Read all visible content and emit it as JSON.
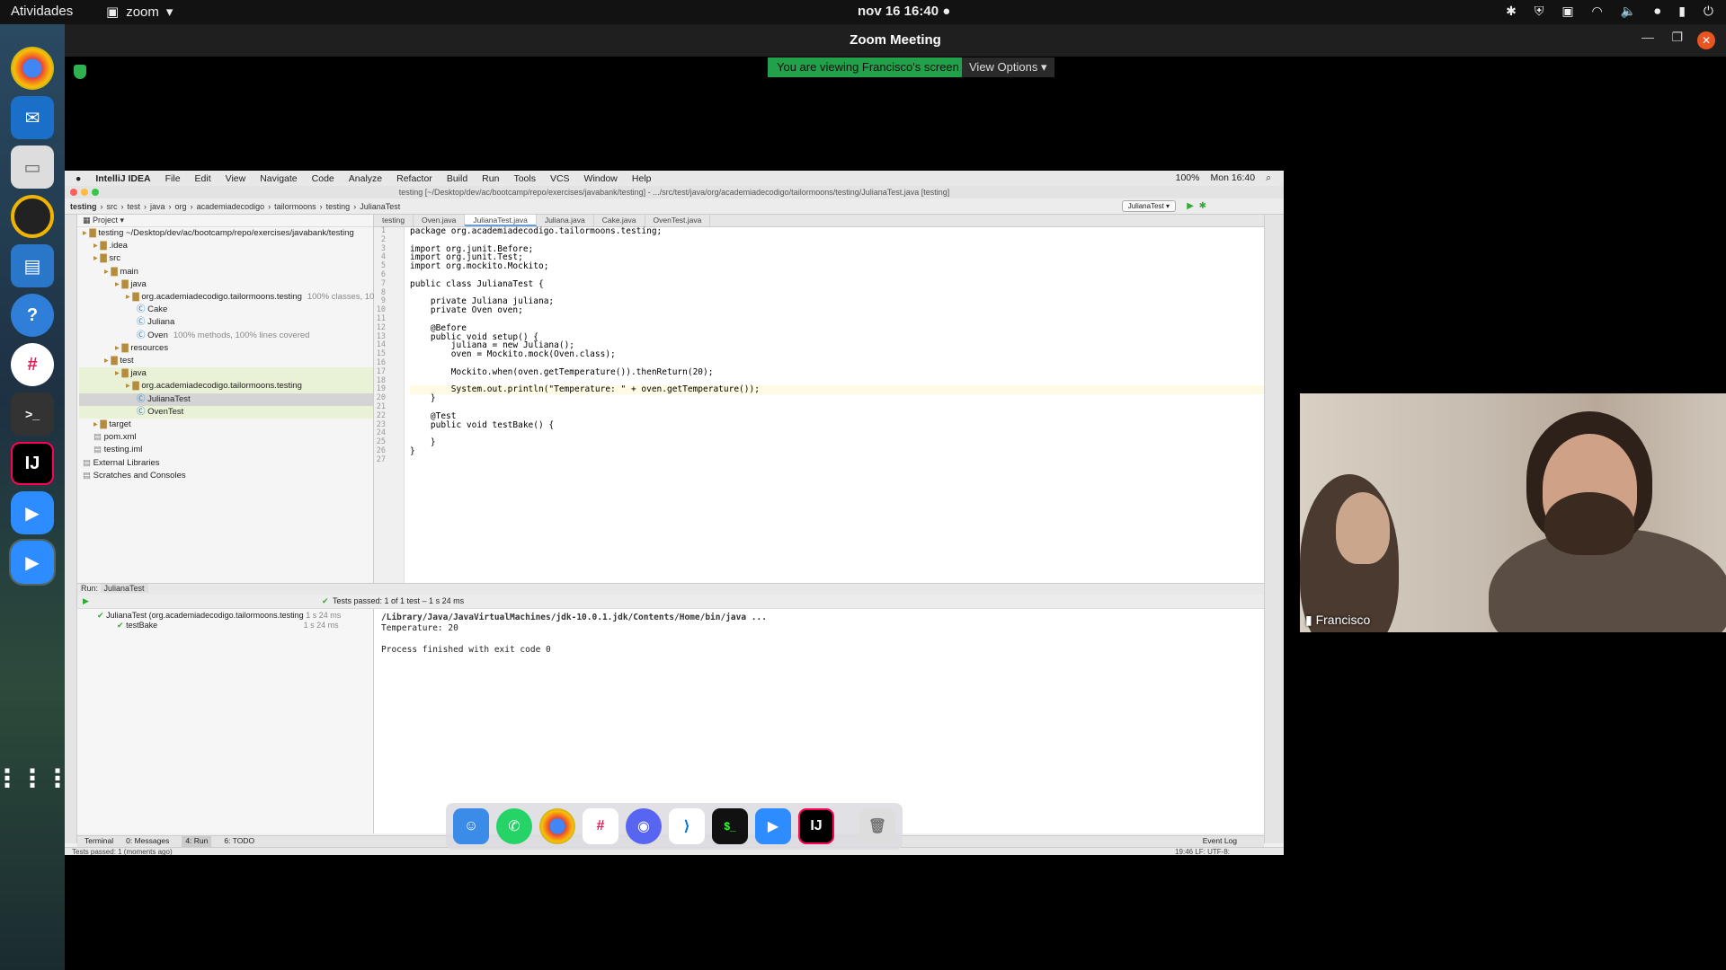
{
  "topbar": {
    "activities": "Atividades",
    "app": "zoom",
    "clock": "nov 16  16:40"
  },
  "zoom": {
    "title": "Zoom Meeting",
    "banner": "You are viewing Francisco's screen",
    "view_options": "View Options",
    "participant": "Francisco"
  },
  "mac": {
    "menu": [
      "IntelliJ IDEA",
      "File",
      "Edit",
      "View",
      "Navigate",
      "Code",
      "Analyze",
      "Refactor",
      "Build",
      "Run",
      "Tools",
      "VCS",
      "Window",
      "Help"
    ],
    "status_right": [
      "100%",
      "Mon 16:40"
    ],
    "title": "testing [~/Desktop/dev/ac/bootcamp/repo/exercises/javabank/testing] - .../src/test/java/org/academiadecodigo/tailormoons/testing/JulianaTest.java [testing]",
    "breadcrumb": [
      "testing",
      "src",
      "test",
      "java",
      "org",
      "academiadecodigo",
      "tailormoons",
      "testing",
      "JulianaTest"
    ],
    "run_config": "JulianaTest"
  },
  "project": {
    "header": "Project",
    "tree": [
      {
        "t": "testing ~/Desktop/dev/ac/bootcamp/repo/exercises/javabank/testing",
        "d": 0,
        "k": "fold"
      },
      {
        "t": ".idea",
        "d": 1,
        "k": "fold"
      },
      {
        "t": "src",
        "d": 1,
        "k": "fold"
      },
      {
        "t": "main",
        "d": 2,
        "k": "fold"
      },
      {
        "t": "java",
        "d": 3,
        "k": "fold"
      },
      {
        "t": "org.academiadecodigo.tailormoons.testing",
        "n": "100% classes, 10",
        "d": 4,
        "k": "fold"
      },
      {
        "t": "Cake",
        "d": 5,
        "k": "cls"
      },
      {
        "t": "Juliana",
        "d": 5,
        "k": "cls"
      },
      {
        "t": "Oven",
        "n": "100% methods, 100% lines covered",
        "d": 5,
        "k": "cls"
      },
      {
        "t": "resources",
        "d": 3,
        "k": "fold"
      },
      {
        "t": "test",
        "d": 2,
        "k": "fold"
      },
      {
        "t": "java",
        "d": 3,
        "k": "fold",
        "h": "hl"
      },
      {
        "t": "org.academiadecodigo.tailormoons.testing",
        "d": 4,
        "k": "fold",
        "h": "hl"
      },
      {
        "t": "JulianaTest",
        "d": 5,
        "k": "cls",
        "h": "sel"
      },
      {
        "t": "OvenTest",
        "d": 5,
        "k": "cls",
        "h": "hl"
      },
      {
        "t": "target",
        "d": 1,
        "k": "fold"
      },
      {
        "t": "pom.xml",
        "d": 1,
        "k": "file"
      },
      {
        "t": "testing.iml",
        "d": 1,
        "k": "file"
      },
      {
        "t": "External Libraries",
        "d": 0,
        "k": "file"
      },
      {
        "t": "Scratches and Consoles",
        "d": 0,
        "k": "file"
      }
    ]
  },
  "tabs": [
    "testing",
    "Oven.java",
    "JulianaTest.java",
    "Juliana.java",
    "Cake.java",
    "OvenTest.java"
  ],
  "code": [
    "package org.academiadecodigo.tailormoons.testing;",
    "",
    "import org.junit.Before;",
    "import org.junit.Test;",
    "import org.mockito.Mockito;",
    "",
    "public class JulianaTest {",
    "",
    "    private Juliana juliana;",
    "    private Oven oven;",
    "",
    "    @Before",
    "    public void setup() {",
    "        juliana = new Juliana();",
    "        oven = Mockito.mock(Oven.class);",
    "",
    "        Mockito.when(oven.getTemperature()).thenReturn(20);",
    "",
    "        System.out.println(\"Temperature: \" + oven.getTemperature());",
    "    }",
    "",
    "    @Test",
    "    public void testBake() {",
    "",
    "    }",
    "}",
    ""
  ],
  "run": {
    "label": "Run:",
    "tab": "JulianaTest",
    "status": "Tests passed: 1 of 1 test – 1 s 24 ms",
    "tree": [
      {
        "t": "JulianaTest (org.academiadecodigo.tailormoons.testing",
        "time": "1 s 24 ms"
      },
      {
        "t": "testBake",
        "time": "1 s 24 ms"
      }
    ],
    "console": [
      "/Library/Java/JavaVirtualMachines/jdk-10.0.1.jdk/Contents/Home/bin/java ...",
      "Temperature: 20",
      "",
      "Process finished with exit code 0"
    ]
  },
  "bottom_tabs": [
    "Terminal",
    "0: Messages",
    "4: Run",
    "6: TODO"
  ],
  "event_log": "Event Log",
  "status": {
    "left": "Tests passed: 1 (moments ago)",
    "right": "19:46  LF:  UTF-8:"
  }
}
